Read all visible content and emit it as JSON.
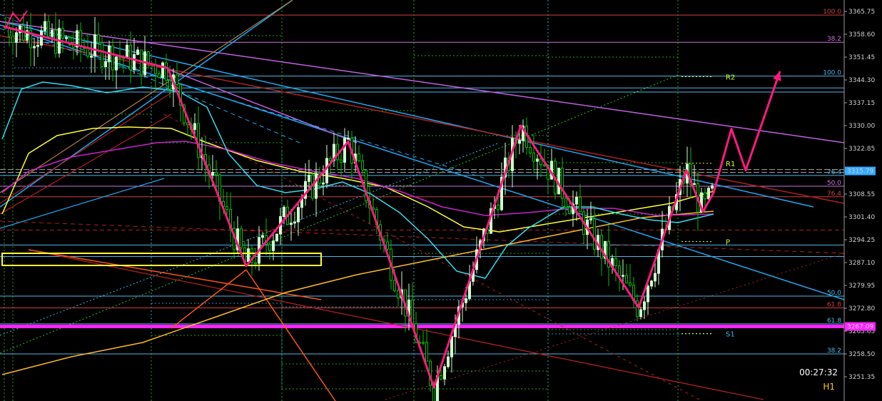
{
  "chart_data": {
    "type": "candlestick",
    "timeframe": "H1",
    "countdown": "00:27:32",
    "ylim": [
      3246.0,
      3369.0
    ],
    "y_ticks": [
      "3365.75",
      "3358.60",
      "3351.45",
      "3344.30",
      "3337.15",
      "3330.00",
      "3322.85",
      "3315.70",
      "3308.55",
      "3301.40",
      "3294.25",
      "3287.10",
      "3279.95",
      "3272.80",
      "3265.65",
      "3258.50",
      "3251.35"
    ],
    "current_price": "3315.79",
    "marked_price": "3267.09",
    "pivot_levels": [
      {
        "name": "R2",
        "value": 3345.3
      },
      {
        "name": "R1",
        "value": 3318.2
      },
      {
        "name": "P",
        "value": 3293.7
      },
      {
        "name": "S1",
        "value": 3264.9
      }
    ],
    "fib_levels": [
      {
        "label": "100.0",
        "value": 3364.6,
        "color": "#d04040"
      },
      {
        "label": "38.2",
        "value": 3356.1,
        "color": "#d070e0"
      },
      {
        "label": "100.0",
        "value": 3345.5,
        "color": "#4fb8e8"
      },
      {
        "label": "76.4",
        "value": 3314.4,
        "color": "#4fb8e8"
      },
      {
        "label": "50.0",
        "value": 3311.0,
        "color": "#d070e0"
      },
      {
        "label": "76.4",
        "value": 3307.7,
        "color": "#d04040"
      },
      {
        "label": "50.0",
        "value": 3276.6,
        "color": "#4fb8e8"
      },
      {
        "label": "61.8",
        "value": 3272.9,
        "color": "#d04040"
      },
      {
        "label": "61.8",
        "value": 3267.9,
        "color": "#4fb8e8"
      },
      {
        "label": "38.2",
        "value": 3258.5,
        "color": "#4fb8e8"
      }
    ],
    "zigzag_pattern": [
      [
        5,
        3361
      ],
      [
        235,
        3348
      ],
      [
        345,
        3286
      ],
      [
        488,
        3325
      ],
      [
        608,
        3248
      ],
      [
        730,
        3330
      ],
      [
        895,
        3273
      ],
      [
        962,
        3316
      ],
      [
        985,
        3303
      ],
      [
        1000,
        3309
      ],
      [
        1025,
        3329
      ],
      [
        1045,
        3316
      ],
      [
        1093,
        3347
      ]
    ],
    "colors": {
      "up": "#ccffcc",
      "down": "#00c000",
      "zigzag": "#ff1a80",
      "pivot": "#ccff33",
      "ma_yellow": "#ffff33",
      "ma_magenta": "#cc22cc",
      "ma_cyan": "#33ddee",
      "ma_orange": "#ffbb22",
      "trend_blue": "#1fa8f0",
      "trend_red": "#b02020",
      "trend_violet": "#c060e0",
      "price_box": "#33aaff",
      "marked_line": "#ff22ff"
    }
  }
}
